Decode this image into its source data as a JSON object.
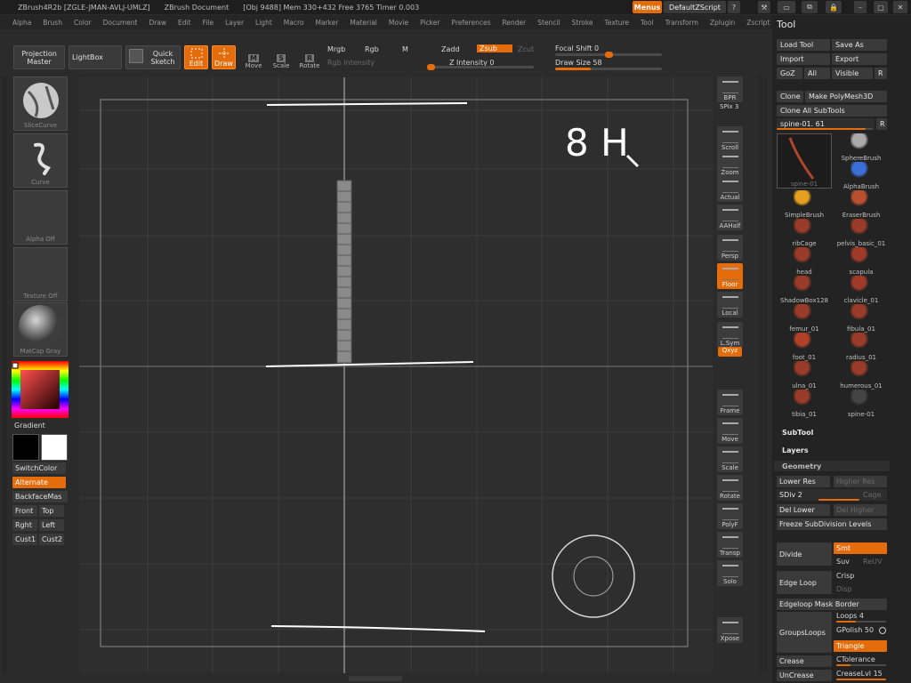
{
  "titlebar": {
    "app": "ZBrush4R2b [ZGLE-JMAN-AVLJ-UMLZ]",
    "doc": "ZBrush Document",
    "stats": "[Obj 9488] Mem 330+432 Free 3765 Timer 0.003",
    "menus_btn": "Menus",
    "script_btn": "DefaultZScript"
  },
  "menu": [
    "Alpha",
    "Brush",
    "Color",
    "Document",
    "Draw",
    "Edit",
    "File",
    "Layer",
    "Light",
    "Macro",
    "Marker",
    "Material",
    "Movie",
    "Picker",
    "Preferences",
    "Render",
    "Stencil",
    "Stroke",
    "Texture",
    "Tool",
    "Transform",
    "Zplugin",
    "Zscript"
  ],
  "shelf": {
    "projection_master": "Projection Master",
    "lightbox": "LightBox",
    "quick_sketch": "Quick Sketch",
    "edit": "Edit",
    "draw": "Draw",
    "move": "Move",
    "scale": "Scale",
    "rotate": "Rotate",
    "move_key": "M",
    "scale_key": "S",
    "rotate_key": "R",
    "mrgb": "Mrgb",
    "rgb": "Rgb",
    "m": "M",
    "rgb_intensity": "Rgb Intensity",
    "zadd": "Zadd",
    "zsub": "Zsub",
    "zcut": "Zcut",
    "z_intensity": "Z Intensity 0",
    "z_intensity_value": 0,
    "focal_shift": "Focal Shift 0",
    "focal_shift_value": 0,
    "draw_size": "Draw Size 58",
    "draw_size_value": 58
  },
  "left": {
    "brush": "SliceCurve",
    "stroke": "Curve",
    "alpha": "Alpha Off",
    "texture": "Texture Off",
    "material": "MatCap Gray",
    "gradient": "Gradient",
    "switch_color": "SwitchColor",
    "alternate": "Alternate",
    "backface": "BackfaceMas",
    "front": "Front",
    "top": "Top",
    "right": "Rght",
    "left_v": "Left",
    "cust1": "Cust1",
    "cust2": "Cust2"
  },
  "canvas": {
    "annotation": "8 H"
  },
  "right_shelf": [
    "BPR",
    "Scroll",
    "Zoom",
    "Actual",
    "AAHalf",
    "Persp",
    "Floor",
    "Local",
    "L.Sym",
    "Frame",
    "Move",
    "Scale",
    "Rotate",
    "PolyF",
    "Transp",
    "Solo",
    "Xpose"
  ],
  "right_shelf_extra": {
    "spix": "SPix 3",
    "xyz": "Qxyz"
  },
  "tool": {
    "title": "Tool",
    "load_tool": "Load Tool",
    "save_as": "Save As",
    "import": "Import",
    "export": "Export",
    "goz": "GoZ",
    "all": "All",
    "visible": "Visible",
    "r": "R",
    "clone": "Clone",
    "make_polymesh": "Make PolyMesh3D",
    "clone_all": "Clone All SubTools",
    "current": "spine-01. 61",
    "current_thumb": "spine-01",
    "subtools": [
      "SphereBrush",
      "AlphaBrush",
      "SimpleBrush",
      "EraserBrush",
      "ribCage",
      "pelvis_basic_01",
      "head",
      "scapula",
      "ShadowBox128",
      "clavicle_01",
      "femur_01",
      "fibula_01",
      "foot_01",
      "radius_01",
      "ulna_01",
      "humerous_01",
      "tibia_01",
      "spine-01"
    ],
    "subtool": "SubTool",
    "layers": "Layers",
    "geometry": "Geometry",
    "lower_res": "Lower Res",
    "higher_res": "Higher Res",
    "sdiv": "SDiv 2",
    "sdiv_value": 2,
    "cage": "Cage",
    "del_lower": "Del Lower",
    "del_higher": "Del Higher",
    "freeze": "Freeze SubDivision Levels",
    "divide": "Divide",
    "smt": "Smt",
    "suv": "Suv",
    "reuv": "ReUV",
    "edge_loop": "Edge Loop",
    "crisp": "Crisp",
    "disp": "Disp",
    "edgeloop_mask": "Edgeloop Mask Border",
    "groups_loops": "GroupsLoops",
    "loops": "Loops 4",
    "gpolish": "GPolish 50",
    "triangle": "Triangle",
    "crease": "Crease",
    "ctolerance": "CTolerance",
    "uncrease": "UnCrease",
    "creaselvl": "CreaseLvl 15"
  },
  "colors": {
    "accent": "#e46c0a",
    "bg": "#2b2b2b"
  }
}
